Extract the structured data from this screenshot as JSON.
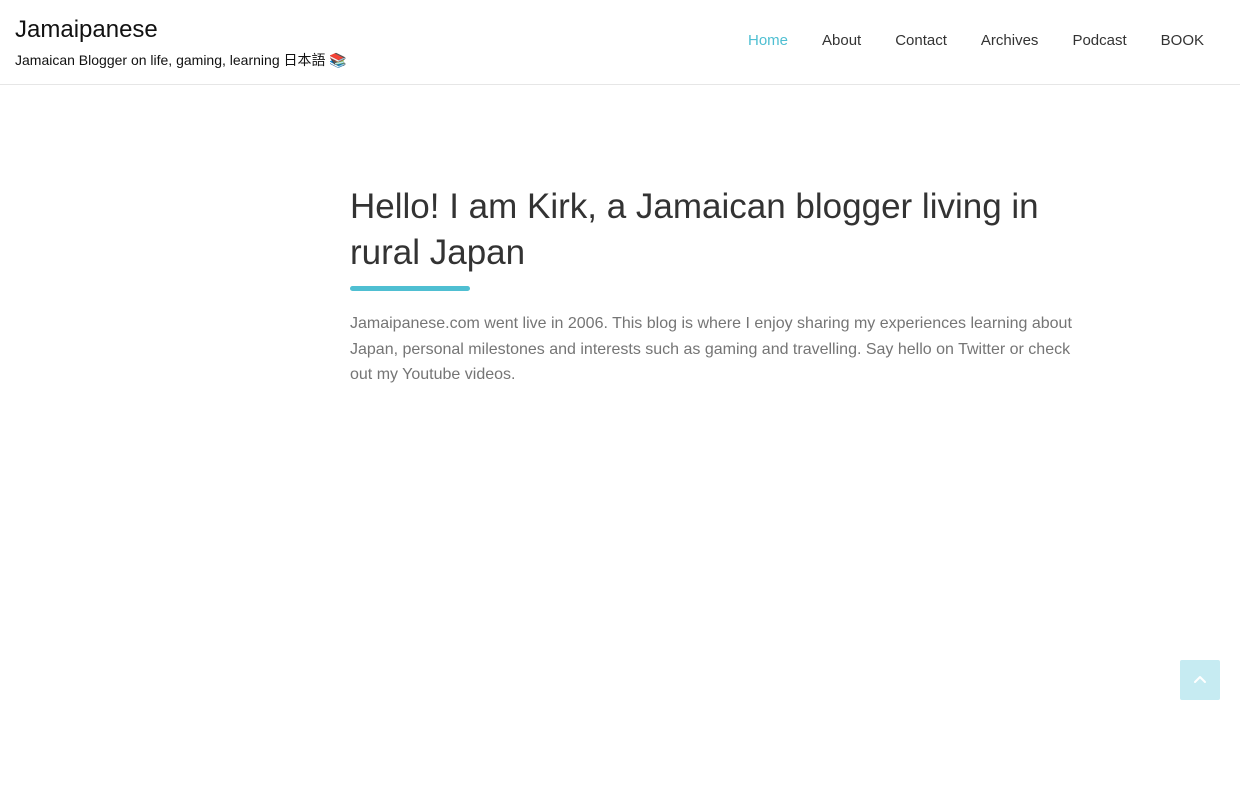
{
  "header": {
    "site_title": "Jamaipanese",
    "tagline": "Jamaican Blogger on life, gaming, learning 日本語 📚"
  },
  "nav": {
    "items": [
      {
        "label": "Home",
        "active": true
      },
      {
        "label": "About"
      },
      {
        "label": "Contact"
      },
      {
        "label": "Archives"
      },
      {
        "label": "Podcast"
      },
      {
        "label": "BOOK"
      }
    ]
  },
  "hero": {
    "title": "Hello! I am Kirk, a Jamaican blogger living in rural Japan",
    "description": "Jamaipanese.com went live in 2006. This blog is where I enjoy sharing my experiences learning about Japan, personal milestones and interests such as gaming and travelling. Say hello on Twitter or check out my Youtube videos."
  },
  "back_to_top": {
    "icon": "arrow-up-icon"
  },
  "colors": {
    "accent": "#4fbfd2",
    "back_to_top_bg": "#c6ebf2",
    "heading": "#333333",
    "body_text": "#757575"
  }
}
